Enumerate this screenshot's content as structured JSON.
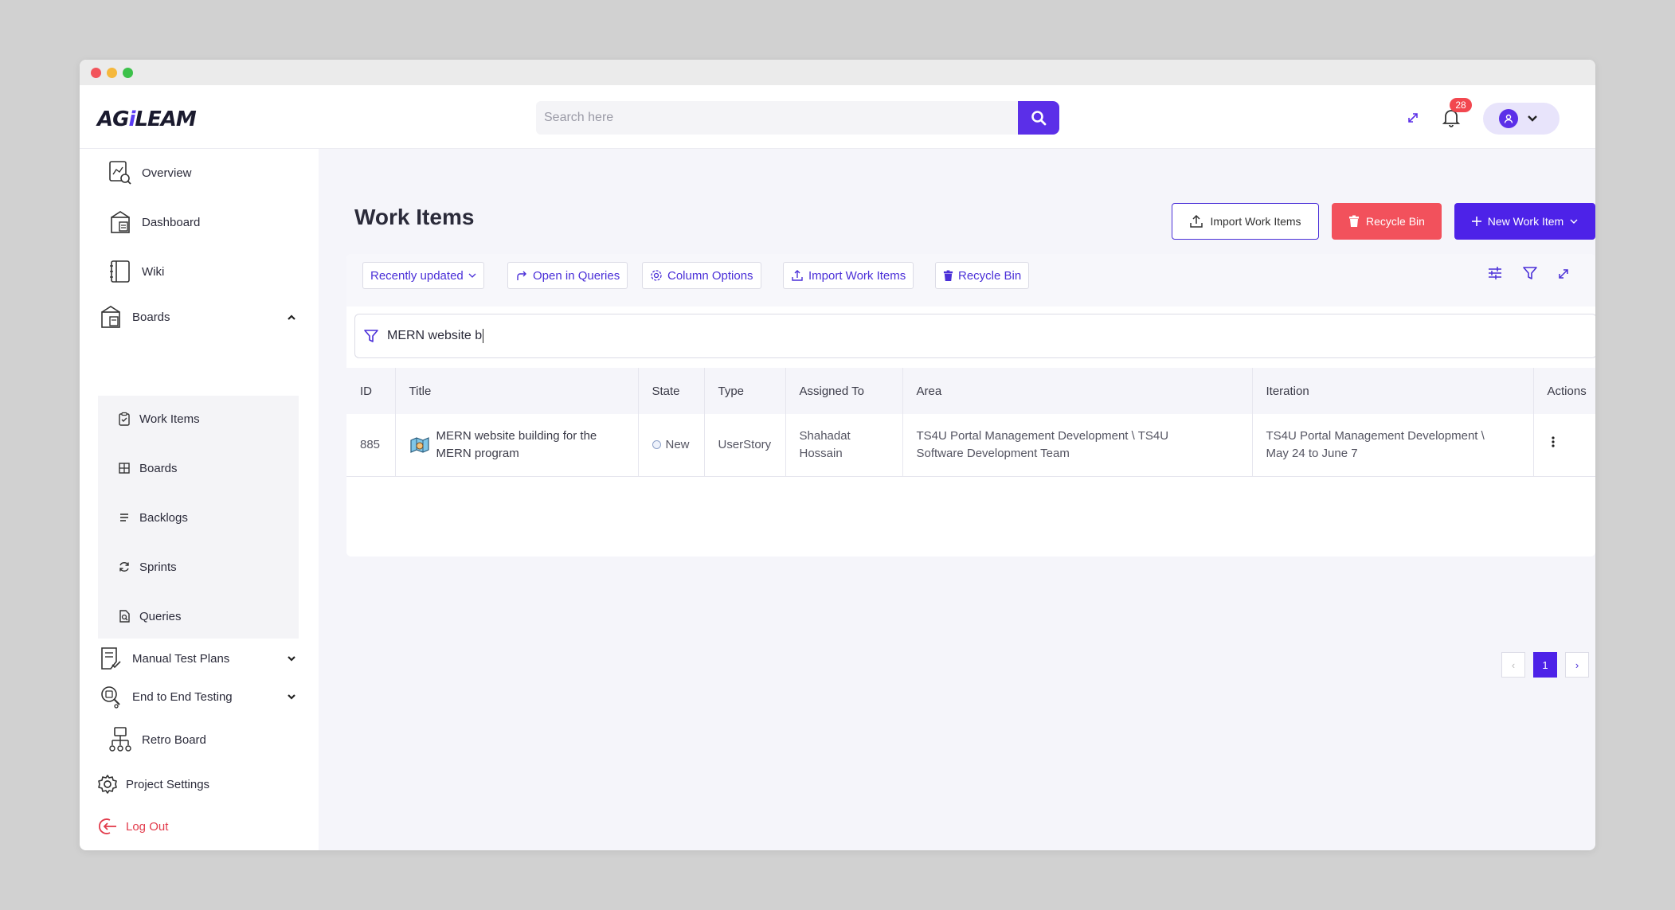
{
  "window": {
    "traffic_lights": [
      "#f2545b",
      "#f5b83d",
      "#3cc14a"
    ]
  },
  "header": {
    "logo_prefix": "AG",
    "logo_accent": "i",
    "logo_suffix": "LEAM",
    "search_placeholder": "Search here",
    "notification_count": "28",
    "accent_color": "#5b2fe8"
  },
  "sidebar": {
    "overview": "Overview",
    "dashboard": "Dashboard",
    "wiki": "Wiki",
    "boards": "Boards",
    "sub_items": [
      "Work Items",
      "Boards",
      "Backlogs",
      "Sprints",
      "Queries"
    ],
    "manual_test_plans": "Manual Test Plans",
    "end_to_end_testing": "End to End Testing",
    "retro_board": "Retro Board",
    "project_settings": "Project Settings",
    "log_out": "Log Out"
  },
  "page": {
    "title": "Work Items",
    "import_button": "Import Work Items",
    "recycle_button": "Recycle Bin",
    "new_button": "New Work Item"
  },
  "toolbar": {
    "sort": "Recently updated",
    "open_in_queries": "Open in Queries",
    "column_options": "Column Options",
    "import": "Import Work Items",
    "recycle": "Recycle Bin"
  },
  "filter": {
    "value": "MERN website b"
  },
  "table": {
    "columns": [
      "ID",
      "Title",
      "State",
      "Type",
      "Assigned To",
      "Area",
      "Iteration",
      "Actions"
    ],
    "rows": [
      {
        "id": "885",
        "title_line1": "MERN website building for the",
        "title_line2": "MERN program",
        "state": "New",
        "type": "UserStory",
        "assigned_line1": "Shahadat",
        "assigned_line2": "Hossain",
        "area_line1": "TS4U Portal Management Development \\ TS4U",
        "area_line2": "Software Development Team",
        "iteration_line1": "TS4U Portal Management Development \\",
        "iteration_line2": "May 24 to June 7"
      }
    ]
  },
  "pagination": {
    "prev": "‹",
    "current": "1",
    "next": "›"
  }
}
